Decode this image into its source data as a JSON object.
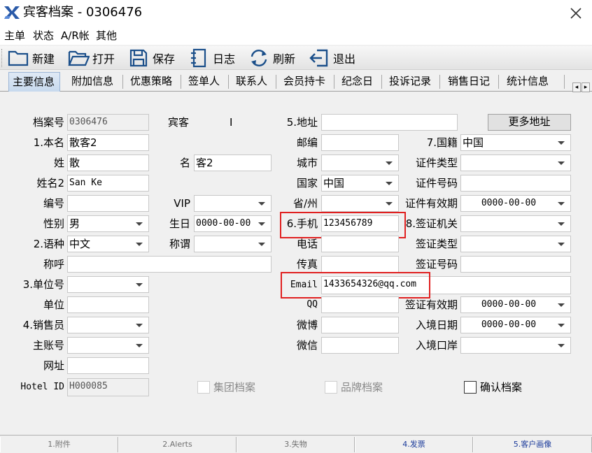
{
  "window": {
    "title": "宾客档案 - 0306476"
  },
  "menu": [
    "主单",
    "状态",
    "A/R帐",
    "其他"
  ],
  "toolbar": {
    "new": "新建",
    "open": "打开",
    "save": "保存",
    "log": "日志",
    "refresh": "刷新",
    "exit": "退出"
  },
  "tabs": [
    "主要信息",
    "附加信息",
    "优惠策略",
    "签单人",
    "联系人",
    "会员持卡",
    "纪念日",
    "投诉记录",
    "销售日记",
    "统计信息"
  ],
  "colors": {
    "highlight_box": "#e02020",
    "active_tab": "#c7d9ee"
  },
  "form": {
    "labels": {
      "profile_no": "档案号",
      "guest": "宾客",
      "address": "5.地址",
      "more_address": "更多地址",
      "full_name": "1.本名",
      "postal": "邮编",
      "nationality": "7.国籍",
      "surname": "姓",
      "given_name": "名",
      "city": "城市",
      "id_type": "证件类型",
      "surname2": "姓名2",
      "country": "国家",
      "id_number": "证件号码",
      "code": "编号",
      "vip": "VIP",
      "province": "省/州",
      "id_expiry": "证件有效期",
      "gender": "性别",
      "birthday": "生日",
      "mobile": "6.手机",
      "visa_authority": "8.签证机关",
      "language": "2.语种",
      "title": "称谓",
      "phone": "电话",
      "visa_type": "签证类型",
      "salutation": "称呼",
      "fax": "传真",
      "visa_no": "签证号码",
      "company_no": "3.单位号",
      "email": "Email",
      "company": "单位",
      "qq": "QQ",
      "visa_expiry": "签证有效期",
      "salesperson": "4.销售员",
      "weibo": "微博",
      "entry_date": "入境日期",
      "master_account": "主账号",
      "wechat": "微信",
      "entry_port": "入境口岸",
      "website": "网址",
      "hotel_id": "Hotel ID"
    },
    "values": {
      "profile_no": "0306476",
      "guest_type": "I",
      "address": "",
      "full_name": "散客2",
      "postal": "",
      "nationality": "中国",
      "surname": "散",
      "given_name": "客2",
      "city": "",
      "id_type": "",
      "surname2": "San Ke",
      "country": "中国",
      "id_number": "",
      "code": "",
      "vip": "",
      "province": "",
      "id_expiry": "0000-00-00",
      "gender": "男",
      "birthday": "0000-00-00",
      "mobile": "123456789",
      "visa_authority": "",
      "language": "中文",
      "title": "",
      "phone": "",
      "visa_type": "",
      "salutation": "",
      "fax": "",
      "visa_no": "",
      "company_no": "",
      "email": "1433654326@qq.com",
      "company": "",
      "qq": "",
      "visa_expiry": "0000-00-00",
      "salesperson": "",
      "weibo": "",
      "entry_date": "0000-00-00",
      "master_account": "",
      "wechat": "",
      "entry_port": "",
      "website": "",
      "hotel_id": "H000085"
    },
    "checkboxes": {
      "group_profile": "集团档案",
      "brand_profile": "品牌档案",
      "confirm_profile": "确认档案"
    }
  },
  "bottom_tabs": [
    "1.附件",
    "2.Alerts",
    "3.失物",
    "4.发票",
    "5.客户画像"
  ]
}
